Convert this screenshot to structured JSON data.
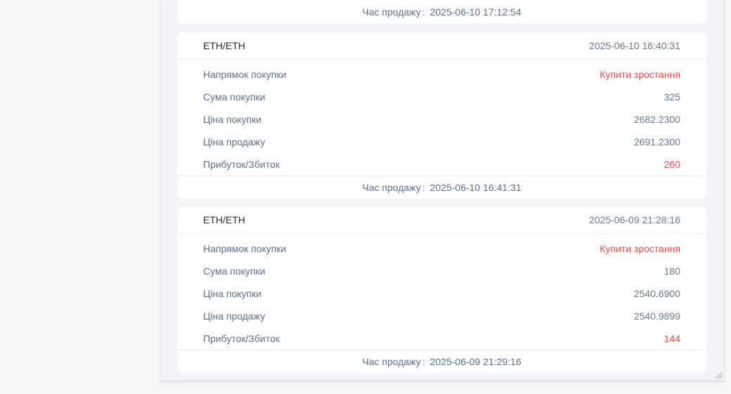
{
  "cards": [
    {
      "sale_time_label": "Час продажу",
      "sale_time": "2025-06-10 17:12:54"
    },
    {
      "pair": "ETH/ETH",
      "date": "2025-06-10 16:40:31",
      "rows": [
        {
          "label": "Напрямок покупки",
          "value": "Купити зростання"
        },
        {
          "label": "Сума покупки",
          "value": "325"
        },
        {
          "label": "Ціна покупки",
          "value": "2682.2300"
        },
        {
          "label": "Ціна продажу",
          "value": "2691.2300"
        },
        {
          "label": "Прибуток/Збиток",
          "value": "260"
        }
      ],
      "sale_time_label": "Час продажу",
      "sale_time": "2025-06-10 16:41:31"
    },
    {
      "pair": "ETH/ETH",
      "date": "2025-06-09 21:28:16",
      "rows": [
        {
          "label": "Напрямок покупки",
          "value": "Купити зростання"
        },
        {
          "label": "Сума покупки",
          "value": "180"
        },
        {
          "label": "Ціна покупки",
          "value": "2540.6900"
        },
        {
          "label": "Ціна продажу",
          "value": "2540.9899"
        },
        {
          "label": "Прибуток/Збиток",
          "value": "144"
        }
      ],
      "sale_time_label": "Час продажу",
      "sale_time": "2025-06-09 21:29:16"
    }
  ],
  "colors": {
    "accent_red": "#f04b4b",
    "label": "#5f6f8f",
    "value": "#6b7b93"
  },
  "icons": {
    "resize": "resize-grip-icon"
  }
}
